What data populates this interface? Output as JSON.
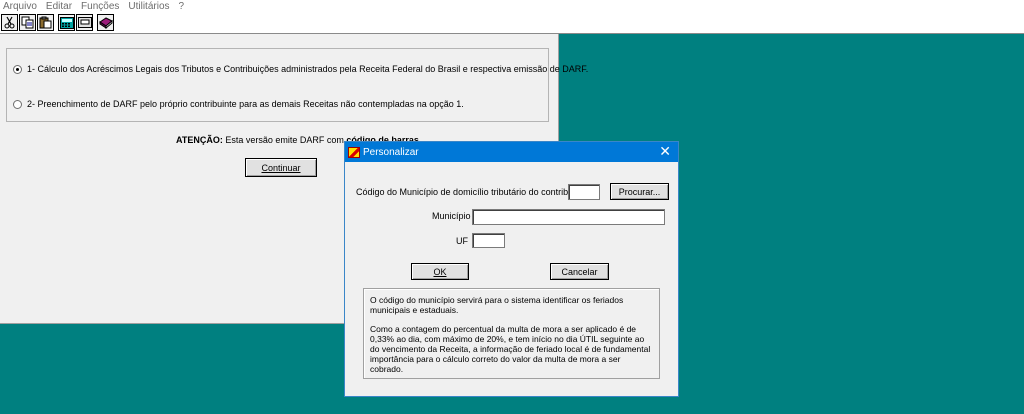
{
  "menubar": {
    "items": [
      "Arquivo",
      "Editar",
      "Funções",
      "Utilitários",
      "?"
    ]
  },
  "toolbar": {
    "icons": [
      "cut-icon",
      "copy-icon",
      "paste-icon",
      "calculator-icon",
      "screen-icon",
      "book-icon"
    ]
  },
  "main": {
    "option1_label": "1- Cálculo dos Acréscimos Legais dos Tributos e Contribuições administrados pela Receita Federal do Brasil  e respectiva emissão de DARF.",
    "option2_label": "2- Preenchimento de DARF pelo próprio contribuinte para as demais Receitas não contempladas na opção 1.",
    "selected_option": 1,
    "attention_label": "ATENÇÃO:",
    "attention_text": " Esta versão emite DARF com ",
    "attention_bold": "código de barras",
    "continue_button": "Continuar"
  },
  "dialog": {
    "title": "Personalizar",
    "close_glyph": "✕",
    "municipio_code_label": "Código do Município de domicílio tributário do contribuinte",
    "municipio_code_value": "",
    "procurar_button": "Procurar...",
    "municipio_label": "Município",
    "municipio_value": "",
    "uf_label": "UF",
    "uf_value": "",
    "ok_button": "OK",
    "cancel_button": "Cancelar",
    "info_paragraph1": "O código do município servirá para o sistema identificar os feriados municipais e estaduais.",
    "info_paragraph2": "Como a contagem do percentual da multa de mora a ser aplicado é de 0,33% ao dia, com máximo de 20%, e tem início no dia ÚTIL seguinte ao do vencimento da Receita, a informação de feriado local é de fundamental importância para o cálculo correto do valor da multa de mora a ser cobrado."
  },
  "colors": {
    "desktop": "#008080",
    "titlebar": "#0078d7",
    "window": "#f0f0f0"
  }
}
